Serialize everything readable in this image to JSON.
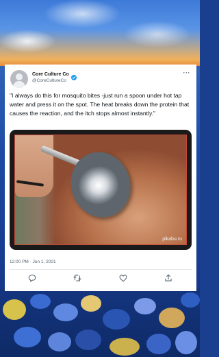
{
  "tweet": {
    "author_name": "Core Culture Co",
    "author_handle": "@CoreCultureCo",
    "more_label": "···",
    "text": "\"I always do this for mosquito bites -just run a spoon under hot tap water and press it on the spot. The heat breaks down the protein that causes the reaction, and the itch stops almost instantly.\"",
    "media_watermark": "pikabu.ru",
    "timestamp": "12:00 PM · Jun 1, 2021"
  },
  "icons": {
    "verified": "verified-badge-icon",
    "reply": "reply-icon",
    "retweet": "retweet-icon",
    "like": "heart-icon",
    "share": "share-icon"
  },
  "colors": {
    "verified_blue": "#1d9bf0",
    "icon_gray": "#536471",
    "photo_border": "#c94a36"
  }
}
